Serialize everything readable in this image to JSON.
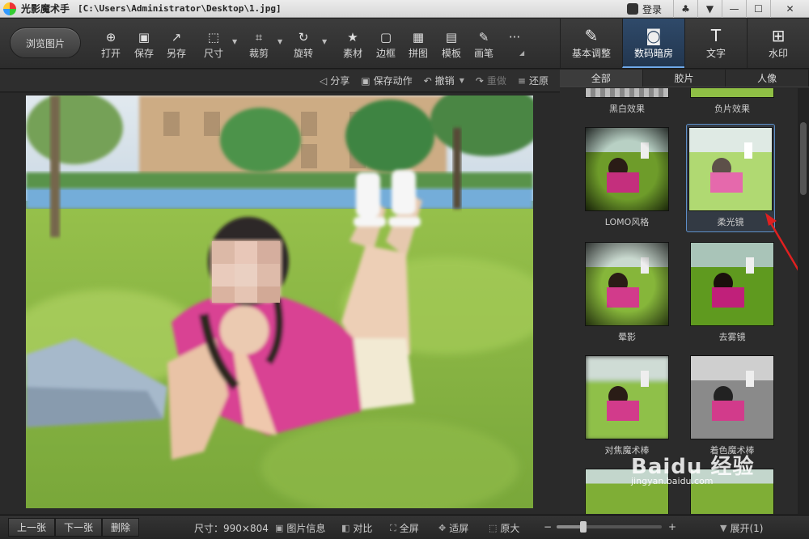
{
  "titlebar": {
    "app_name": "光影魔术手",
    "file_path": "[C:\\Users\\Administrator\\Desktop\\1.jpg]",
    "login_label": "登录",
    "controls": [
      "♣",
      "▼",
      "—",
      "☐",
      "✕"
    ]
  },
  "toolbar": {
    "browse_label": "浏览图片",
    "tools": [
      {
        "label": "打开",
        "icon": "open-icon"
      },
      {
        "label": "保存",
        "icon": "save-icon"
      },
      {
        "label": "另存",
        "icon": "save-as-icon"
      },
      {
        "label": "尺寸",
        "icon": "resize-icon"
      },
      {
        "label": "裁剪",
        "icon": "crop-icon"
      },
      {
        "label": "旋转",
        "icon": "rotate-icon"
      },
      {
        "label": "素材",
        "icon": "sticker-icon"
      },
      {
        "label": "边框",
        "icon": "frame-icon"
      },
      {
        "label": "拼图",
        "icon": "collage-icon"
      },
      {
        "label": "模板",
        "icon": "template-icon"
      },
      {
        "label": "画笔",
        "icon": "brush-icon"
      },
      {
        "label": "···",
        "icon": "more-icon"
      }
    ]
  },
  "right_tabs": [
    {
      "label": "基本调整",
      "icon": "adjust-icon",
      "active": false
    },
    {
      "label": "数码暗房",
      "icon": "darkroom-icon",
      "active": true
    },
    {
      "label": "文字",
      "icon": "text-icon",
      "active": false
    },
    {
      "label": "水印",
      "icon": "watermark-icon",
      "active": false
    }
  ],
  "actionbar": {
    "share": "分享",
    "save_action": "保存动作",
    "undo": "撤销",
    "redo": "重做",
    "restore": "还原"
  },
  "categories": [
    {
      "label": "全部",
      "active": true
    },
    {
      "label": "胶片",
      "active": false
    },
    {
      "label": "人像",
      "active": false
    }
  ],
  "filters": [
    {
      "label": "黑白效果",
      "style": "bw"
    },
    {
      "label": "负片效果",
      "style": "negative"
    },
    {
      "label": "LOMO风格",
      "style": "lomo"
    },
    {
      "label": "柔光镜",
      "style": "soft",
      "selected": true
    },
    {
      "label": "晕影",
      "style": "vignette"
    },
    {
      "label": "去雾镜",
      "style": "dehaze"
    },
    {
      "label": "对焦魔术棒",
      "style": "focus"
    },
    {
      "label": "着色魔术棒",
      "style": "colorize"
    }
  ],
  "statusbar": {
    "prev": "上一张",
    "next": "下一张",
    "delete": "删除",
    "size_label": "尺寸：990×804",
    "info": "图片信息",
    "compare": "对比",
    "fullscreen": "全屏",
    "fit": "适屏",
    "original": "原大",
    "zoom_out": "−",
    "zoom_in": "+",
    "zoom_level": 0.25,
    "expand": "展开(1)"
  },
  "watermark": {
    "logo": "Baidu 经验",
    "url": "jingyan.baidu.com"
  },
  "colors": {
    "accent": "#5d8fc8",
    "active_tab": "#2f4a6a",
    "annotation_arrow": "#e02020"
  }
}
